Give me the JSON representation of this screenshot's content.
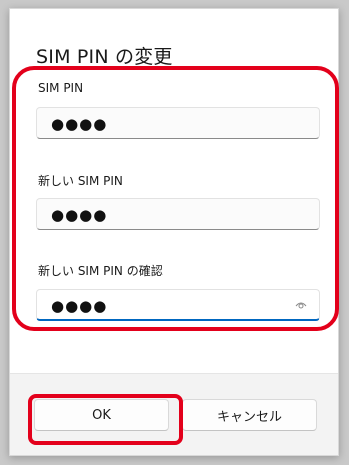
{
  "background": {
    "partial_text_top": "",
    "partial_text_bottom": ""
  },
  "dialog": {
    "title": "SIM PIN の変更",
    "fields": [
      {
        "label": "SIM PIN",
        "value": "●●●●"
      },
      {
        "label": "新しい SIM PIN",
        "value": "●●●●"
      },
      {
        "label": "新しい SIM PIN の確認",
        "value": "●●●●"
      }
    ],
    "reveal_icon": "eye-icon",
    "ok_label": "OK",
    "cancel_label": "キャンセル"
  },
  "colors": {
    "highlight": "#e3001b",
    "focus_accent": "#0067c0"
  }
}
